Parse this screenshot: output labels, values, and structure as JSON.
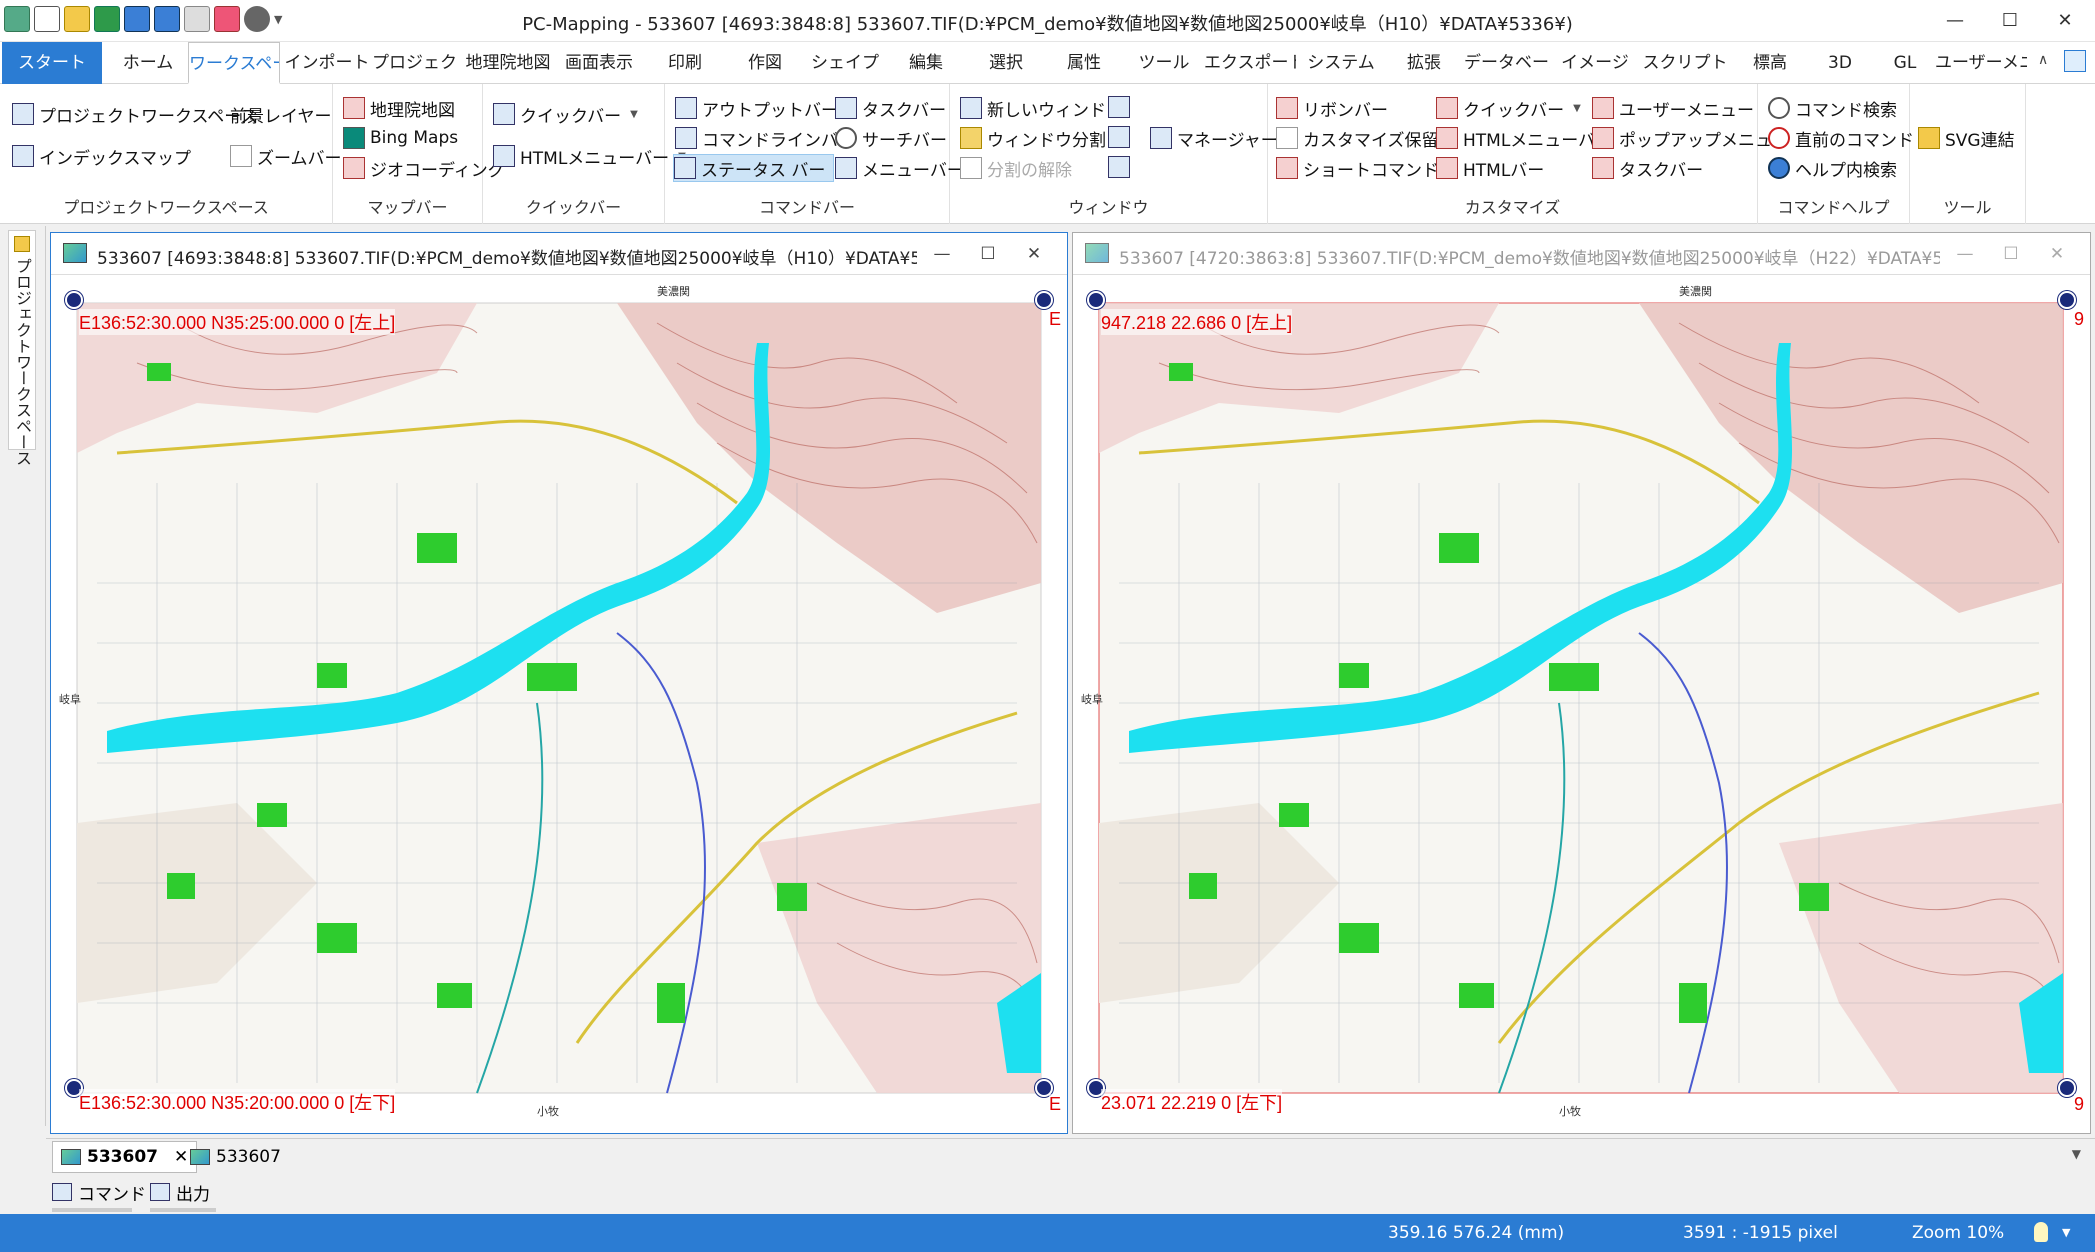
{
  "window": {
    "title": "PC-Mapping - 533607 [4693:3848:8] 533607.TIF(D:¥PCM_demo¥数値地図¥数値地図25000¥岐阜（H10）¥DATA¥5336¥)",
    "minimize": "—",
    "maximize": "☐",
    "close": "✕"
  },
  "quick_access": [
    "app-icon",
    "new-icon",
    "open-icon",
    "excel-icon",
    "import-icon",
    "export-icon",
    "copy-icon",
    "palette-icon",
    "gear-icon",
    "dropdown-icon"
  ],
  "tabs": [
    "スタート",
    "ホーム",
    "ワークスペース",
    "インポート",
    "プロジェクト",
    "地理院地図",
    "画面表示",
    "印刷",
    "作図",
    "シェイプ",
    "編集",
    "選択",
    "属性",
    "ツール",
    "エクスポート",
    "システム",
    "拡張",
    "データベース",
    "イメージ",
    "スクリプト",
    "標高",
    "3D",
    "GL",
    "ユーザーメニュー"
  ],
  "ribbon": {
    "groups": [
      {
        "label": "プロジェクトワークスペース",
        "items": [
          "プロジェクトワークスペース",
          "インデックスマップ",
          "前景レイヤー",
          "ズームバー"
        ]
      },
      {
        "label": "マップバー",
        "items": [
          "地理院地図",
          "Bing Maps",
          "ジオコーディング"
        ]
      },
      {
        "label": "クイックバー",
        "items": [
          "クイックバー",
          "HTMLメニューバー"
        ]
      },
      {
        "label": "コマンドバー",
        "items": [
          "アウトプットバー",
          "コマンドラインバー",
          "ステータス バー",
          "タスクバー",
          "サーチバー",
          "メニューバー"
        ]
      },
      {
        "label": "ウィンドウ",
        "items": [
          "新しいウィンドウ",
          "ウィンドウ分割",
          "分割の解除",
          "マネージャー"
        ]
      },
      {
        "label": "カスタマイズ",
        "items": [
          "リボンバー",
          "カスタマイズ保留",
          "ショートコマンド",
          "クイックバー",
          "HTMLメニューバー",
          "HTMLバー",
          "ユーザーメニュー",
          "ポップアップメニュー",
          "タスクバー"
        ]
      },
      {
        "label": "コマンドヘルプ",
        "items": [
          "コマンド検索",
          "直前のコマンド",
          "ヘルプ内検索"
        ]
      },
      {
        "label": "ツール",
        "items": [
          "SVG連結"
        ]
      }
    ]
  },
  "left_dock": {
    "label": "プロジェクトワークスペース"
  },
  "map_windows": [
    {
      "title": "533607 [4693:3848:8] 533607.TIF(D:¥PCM_demo¥数値地図¥数値地図25000¥岐阜（H10）¥DATA¥5...",
      "coord_top_left": "E136:52:30.000 N35:25:00.000 0 [左上]",
      "coord_bottom_left": "E136:52:30.000 N35:20:00.000 0 [左下]",
      "edge_right_char": "E",
      "map_labels": [
        "美濃関",
        "小牧",
        "岐阜"
      ]
    },
    {
      "title": "533607 [4720:3863:8] 533607.TIF(D:¥PCM_demo¥数値地図¥数値地図25000¥岐阜（H22）¥DATA¥5...",
      "coord_top_left": "947.218 22.686 0 [左上]",
      "coord_bottom_left": "23.071 22.219 0 [左下]",
      "edge_right_char": "9",
      "map_labels": [
        "美濃関",
        "小牧",
        "岐阜"
      ]
    }
  ],
  "doc_tabs": [
    {
      "label": "533607",
      "active": true,
      "close": "✕"
    },
    {
      "label": "533607",
      "active": false
    }
  ],
  "panel_tabs": [
    "コマンド",
    "出力"
  ],
  "status": {
    "mm": "359.16  576.24 (mm)",
    "pixel": "3591 : -1915 pixel",
    "zoom": "Zoom  10%"
  },
  "colors": {
    "accent": "#2b7cd3",
    "coord_text": "#e00000",
    "river": "#00e5ff",
    "contour": "#a0302a",
    "park": "#22cc22"
  }
}
